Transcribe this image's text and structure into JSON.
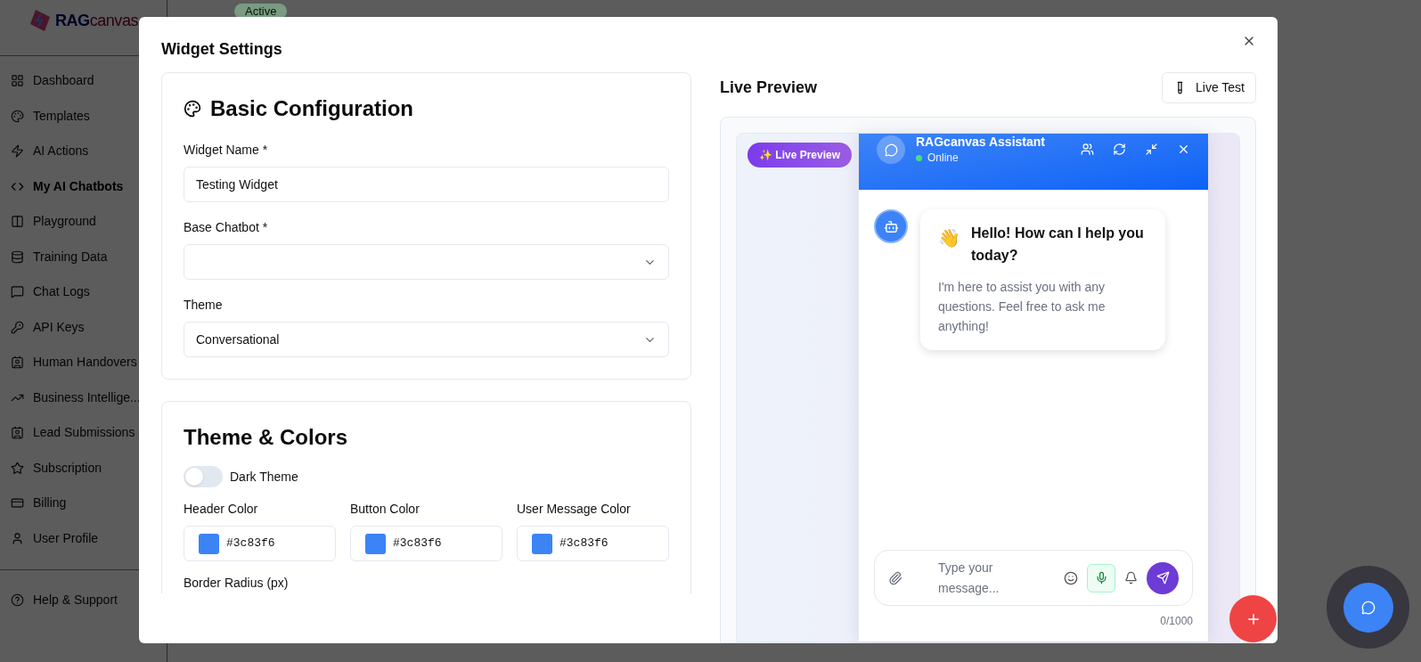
{
  "app": {
    "logo": [
      "RAG",
      "canvas"
    ],
    "status_badge": "Active"
  },
  "sidebar": {
    "items": [
      {
        "label": "Dashboard",
        "selected": false
      },
      {
        "label": "Templates",
        "selected": false
      },
      {
        "label": "AI Actions",
        "selected": false
      },
      {
        "label": "My AI Chatbots",
        "selected": true
      },
      {
        "label": "Playground",
        "selected": false
      },
      {
        "label": "Training Data",
        "selected": false
      },
      {
        "label": "Chat Logs",
        "selected": false
      },
      {
        "label": "API Keys",
        "selected": false
      },
      {
        "label": "Human Handovers",
        "selected": false
      },
      {
        "label": "Business Intellige...",
        "selected": false
      },
      {
        "label": "Lead Submissions",
        "selected": false
      },
      {
        "label": "Subscription",
        "selected": false
      },
      {
        "label": "Billing",
        "selected": false
      },
      {
        "label": "User Profile",
        "selected": false
      }
    ],
    "footer_items": [
      {
        "label": "Help & Support",
        "selected": false
      }
    ]
  },
  "modal": {
    "title": "Widget Settings",
    "basic_configuration": {
      "title": "Basic Configuration",
      "widget_name": {
        "label": "Widget Name *",
        "value": "Testing Widget"
      },
      "base_chatbot": {
        "label": "Base Chatbot *"
      },
      "theme": {
        "label": "Theme",
        "value": "Conversational"
      }
    },
    "theme_colors": {
      "title": "Theme & Colors",
      "dark_theme": {
        "label": "Dark Theme",
        "on": false
      },
      "colors": [
        {
          "label": "Header Color",
          "value": "#3c83f6",
          "color": "#3c83f6"
        },
        {
          "label": "Button Color",
          "value": "#3c83f6",
          "color": "#3c83f6"
        },
        {
          "label": "User Message Color",
          "value": "#3c83f6",
          "color": "#3c83f6"
        }
      ],
      "border_radius": {
        "label": "Border Radius (px)"
      }
    },
    "live_preview": {
      "title": "Live Preview",
      "live_test_button": "Live Test",
      "badge": "✨ Live Preview",
      "chat": {
        "title": "RAGcanvas Assistant",
        "status": "Online",
        "greeting_emoji": "👋",
        "greeting": "Hello! How can I help you today?",
        "message": "I'm here to assist you with any questions. Feel free to ask me anything!",
        "input_placeholder": "Type your message...",
        "voice_on": true,
        "counter": "0/1000"
      }
    }
  }
}
